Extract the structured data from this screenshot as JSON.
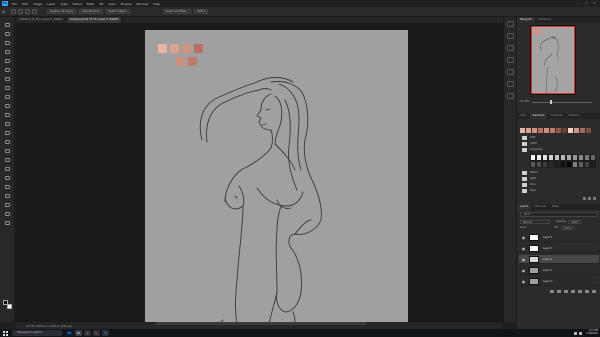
{
  "app": {
    "menu_items": [
      "File",
      "Edit",
      "Image",
      "Layer",
      "Type",
      "Select",
      "Filter",
      "3D",
      "View",
      "Plugins",
      "Window",
      "Help"
    ],
    "window_controls": [
      "–",
      "□",
      "✕"
    ]
  },
  "options_bar": {
    "items": [
      "Sample: All Layers",
      "Auto-Enhance",
      "Select Subject",
      "Select and Mask...",
      "Refine"
    ]
  },
  "document_tabs": [
    {
      "label": "Untitled-1 @ 25% (Layer 1, RGB/8)",
      "active": false
    },
    {
      "label": "drawing.psd @ 33.3% (Layer 3, RGB/8)",
      "active": true
    }
  ],
  "canvas": {
    "palette_colors": [
      "#e8b4a4",
      "#dca08f",
      "#d19383",
      "#bb6f62",
      "#cd8d7f",
      "#bf7b6c"
    ]
  },
  "status_bar": {
    "text": "33.33%    5000 px x 7000 px (300 ppi)"
  },
  "navigator": {
    "tabs": [
      "Navigator",
      "Histogram"
    ],
    "zoom": "33.33%"
  },
  "swatches": {
    "tabs": [
      "Color",
      "Swatches",
      "Gradients",
      "Patterns"
    ],
    "recent": [
      "#e8b4a4",
      "#dca08f",
      "#d19383",
      "#bb6f62",
      "#cd8d7f",
      "#bf7b6c",
      "#8f5a50",
      "#6b4038",
      "#f2d2c6",
      "#cc9a8c",
      "#a06b60",
      "#7a4e44"
    ],
    "folders_top": [
      "RGB",
      "CMYK",
      "Grayscale"
    ],
    "grays": [
      "#ffffff",
      "#f0f0f0",
      "#e1e1e1",
      "#d2d2d2",
      "#c3c3c3",
      "#b4b4b4",
      "#a5a5a5",
      "#969696",
      "#878787",
      "#787878",
      "#696969",
      "#5a5a5a",
      "#4b4b4b",
      "#3c3c3c",
      "#2d2d2d",
      "#1e1e1e",
      "#0f0f0f",
      "#000000",
      "#808080",
      "#606060",
      "#404040",
      "#202020"
    ],
    "folders_bottom": [
      "Pastel",
      "Light",
      "Pure",
      "Dark"
    ]
  },
  "layers": {
    "tabs": [
      "Layers",
      "Channels",
      "Paths"
    ],
    "kind_label": "Kind",
    "blend_mode": "Normal",
    "opacity_label": "Opacity:",
    "opacity_value": "100%",
    "lock_label": "Lock:",
    "fill_label": "Fill:",
    "fill_value": "100%",
    "rows": [
      {
        "name": "Layer 4",
        "visible": true,
        "active": false,
        "thumb": "#ffffff"
      },
      {
        "name": "Layer 3",
        "visible": true,
        "active": false,
        "thumb": "#ffffff"
      },
      {
        "name": "Layer 2",
        "visible": true,
        "active": true,
        "thumb": "#d9d9d9"
      },
      {
        "name": "Layer 1",
        "visible": true,
        "active": false,
        "thumb": "#a0a0a0"
      },
      {
        "name": "Layer 0",
        "visible": true,
        "active": false,
        "thumb": "#a0a0a0"
      }
    ]
  },
  "taskbar": {
    "search_placeholder": "Type here to search",
    "apps": [
      {
        "label": "Ps",
        "bg": "#001e36",
        "fg": "#31a8ff"
      },
      {
        "label": "⊞",
        "bg": "#3a3f4a",
        "fg": "#dddddd"
      },
      {
        "label": "◉",
        "bg": "#2b2f38",
        "fg": "#e8553f"
      },
      {
        "label": "▶",
        "bg": "#2b2f38",
        "fg": "#e94040"
      },
      {
        "label": "✉",
        "bg": "#2b2f38",
        "fg": "#4aa3ff"
      }
    ],
    "time": "1:21 PM",
    "date": "1/18/2022"
  }
}
